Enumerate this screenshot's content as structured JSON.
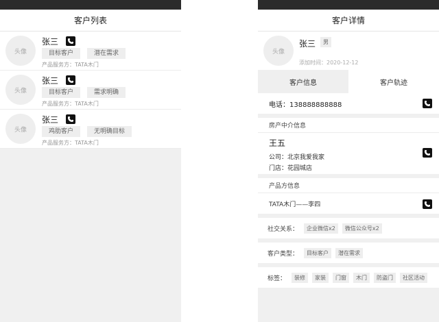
{
  "left": {
    "title": "客户列表",
    "items": [
      {
        "avatar": "头像",
        "name": "张三",
        "tags": [
          "目标客户",
          "潜在需求"
        ],
        "service": "产品服务方：TATA木门"
      },
      {
        "avatar": "头像",
        "name": "张三",
        "tags": [
          "目标客户",
          "需求明确"
        ],
        "service": "产品服务方：TATA木门"
      },
      {
        "avatar": "头像",
        "name": "张三",
        "tags": [
          "鸡肋客户",
          "无明确目标"
        ],
        "service": "产品服务方：TATA木门"
      }
    ]
  },
  "right": {
    "title": "客户详情",
    "profile": {
      "avatar": "头像",
      "name": "张三",
      "gender": "男",
      "added": "添加时间：2020-12-12"
    },
    "tabs": [
      "客户信息",
      "客户轨迹"
    ],
    "phone": "电话：138888888888",
    "agency": {
      "title": "房产中介信息",
      "name": "王五",
      "company": "公司：北京我爱我家",
      "store": "门店：花园城店"
    },
    "product": {
      "title": "产品方信息",
      "value": "TATA木门——李四"
    },
    "social": {
      "label": "社交关系：",
      "items": [
        "企业微信x2",
        "微信公众号x2"
      ]
    },
    "type": {
      "label": "客户类型：",
      "items": [
        "目标客户",
        "潜在需求"
      ]
    },
    "tags": {
      "label": "标签：",
      "items": [
        "装修",
        "家装",
        "门窗",
        "木门",
        "防盗门",
        "社区活动"
      ]
    }
  }
}
